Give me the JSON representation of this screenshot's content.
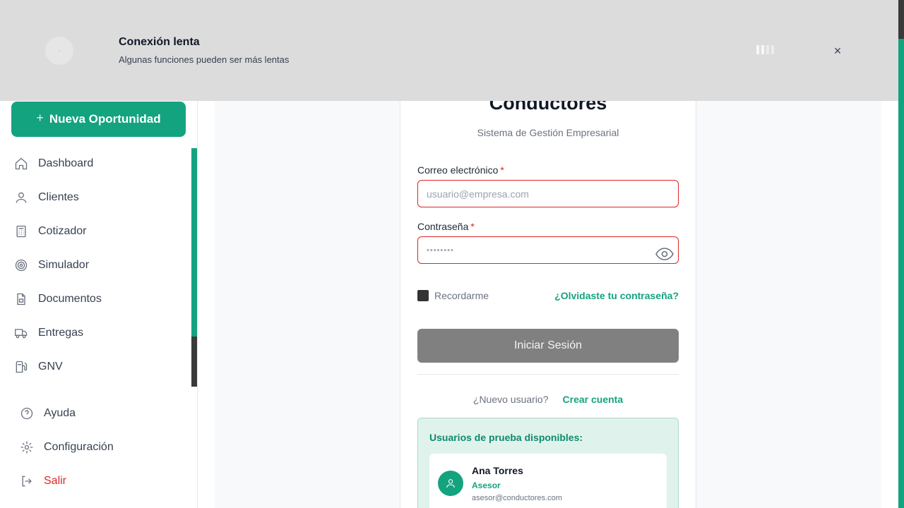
{
  "sidebar": {
    "new_button": "Nueva Oportunidad",
    "new_button_icon": "plus-icon",
    "items": [
      {
        "label": "Dashboard",
        "icon": "home-icon"
      },
      {
        "label": "Clientes",
        "icon": "user-icon"
      },
      {
        "label": "Cotizador",
        "icon": "calculator-icon"
      },
      {
        "label": "Simulador",
        "icon": "target-icon"
      },
      {
        "label": "Documentos",
        "icon": "document-icon"
      },
      {
        "label": "Entregas",
        "icon": "truck-icon"
      },
      {
        "label": "GNV",
        "icon": "fuel-icon"
      }
    ],
    "footer": [
      {
        "label": "Ayuda",
        "icon": "help-icon"
      },
      {
        "label": "Configuración",
        "icon": "settings-icon"
      },
      {
        "label": "Salir",
        "icon": "logout-icon"
      }
    ]
  },
  "login": {
    "title": "Conductores",
    "subtitle": "Sistema de Gestión Empresarial",
    "email_label": "Correo electrónico",
    "email_placeholder": "usuario@empresa.com",
    "password_label": "Contraseña",
    "password_placeholder": "••••••••",
    "required_mark": "*",
    "remember_label": "Recordarme",
    "forgot_link": "¿Olvidaste tu contraseña?",
    "submit": "Iniciar Sesión",
    "new_user_text": "¿Nuevo usuario?",
    "create_account": "Crear cuenta",
    "test_users_title": "Usuarios de prueba disponibles:",
    "test_user": {
      "name": "Ana Torres",
      "role": "Asesor",
      "email": "asesor@conductores.com"
    }
  },
  "toast": {
    "title": "Conexión lenta",
    "message": "Algunas funciones pueden ser más lentas",
    "close": "×"
  },
  "colors": {
    "accent": "#14a37f",
    "error": "#dc2626",
    "toast_bg": "#dcdcdc"
  }
}
